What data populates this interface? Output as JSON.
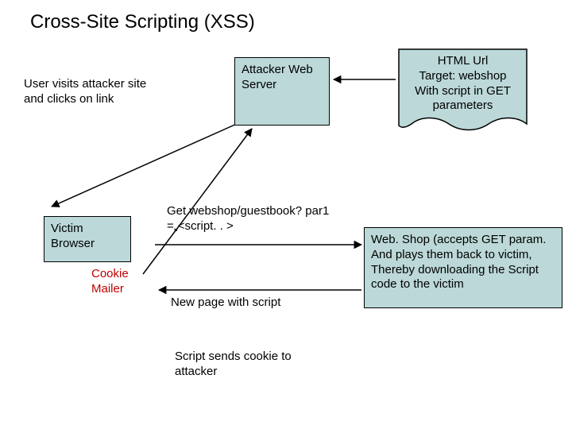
{
  "title": "Cross-Site Scripting (XSS)",
  "labels": {
    "user_visits": "User visits attacker site and clicks on link",
    "get_request": "Get webshop/guestbook? par1 =„<script. . >",
    "new_page": "New page with script",
    "sends_cookie": "Script sends cookie to attacker"
  },
  "nodes": {
    "attacker_web_server": "Attacker Web Server",
    "victim_browser": "Victim Browser",
    "cookie_mailer": "Cookie Mailer",
    "webshop": "Web. Shop (accepts GET param. And plays them back to victim, Thereby downloading the Script code to the victim"
  },
  "html_url": {
    "l1": "HTML Url",
    "l2": "Target: webshop",
    "l3": "With script in GET",
    "l4": "parameters"
  }
}
